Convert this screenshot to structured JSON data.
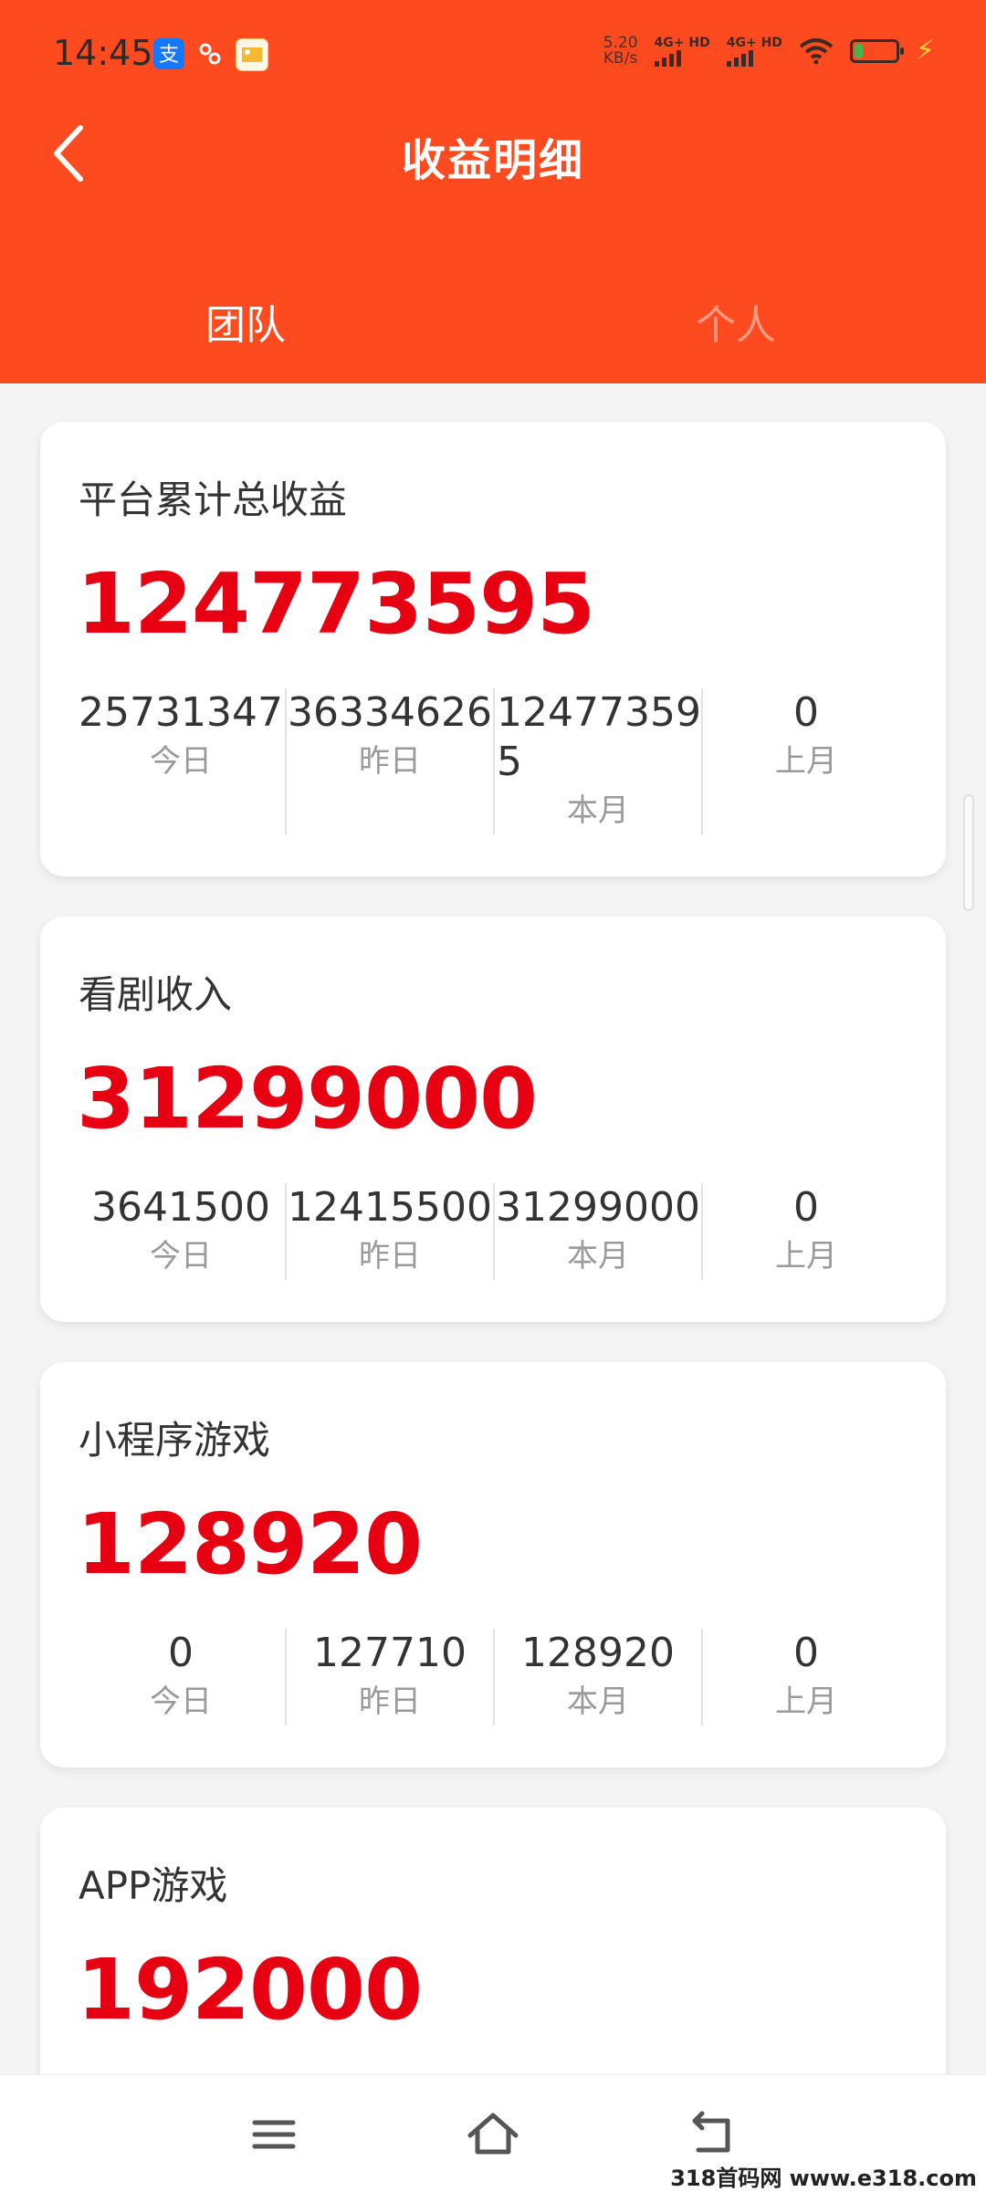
{
  "status_bar": {
    "time": "14:45",
    "net_speed_value": "5.20",
    "net_speed_unit": "KB/s",
    "sim1_label": "4G+ HD",
    "sim2_label": "4G+ HD",
    "battery_level": 0.2
  },
  "header": {
    "title": "收益明细",
    "tabs": [
      {
        "label": "团队",
        "active": true
      },
      {
        "label": "个人",
        "active": false
      }
    ]
  },
  "cards": [
    {
      "title": "平台累计总收益",
      "total": "124773595",
      "stats": [
        {
          "value": "25731347",
          "label": "今日"
        },
        {
          "value": "36334626",
          "label": "昨日"
        },
        {
          "value": "124773595",
          "label": "本月"
        },
        {
          "value": "0",
          "label": "上月"
        }
      ]
    },
    {
      "title": "看剧收入",
      "total": "31299000",
      "stats": [
        {
          "value": "3641500",
          "label": "今日"
        },
        {
          "value": "12415500",
          "label": "昨日"
        },
        {
          "value": "31299000",
          "label": "本月"
        },
        {
          "value": "0",
          "label": "上月"
        }
      ]
    },
    {
      "title": "小程序游戏",
      "total": "128920",
      "stats": [
        {
          "value": "0",
          "label": "今日"
        },
        {
          "value": "127710",
          "label": "昨日"
        },
        {
          "value": "128920",
          "label": "本月"
        },
        {
          "value": "0",
          "label": "上月"
        }
      ]
    },
    {
      "title": "APP游戏",
      "total": "192000"
    }
  ],
  "watermark": "318首码网 www.e318.com",
  "colors": {
    "brand": "#fe4a1f",
    "amount": "#e60012"
  }
}
